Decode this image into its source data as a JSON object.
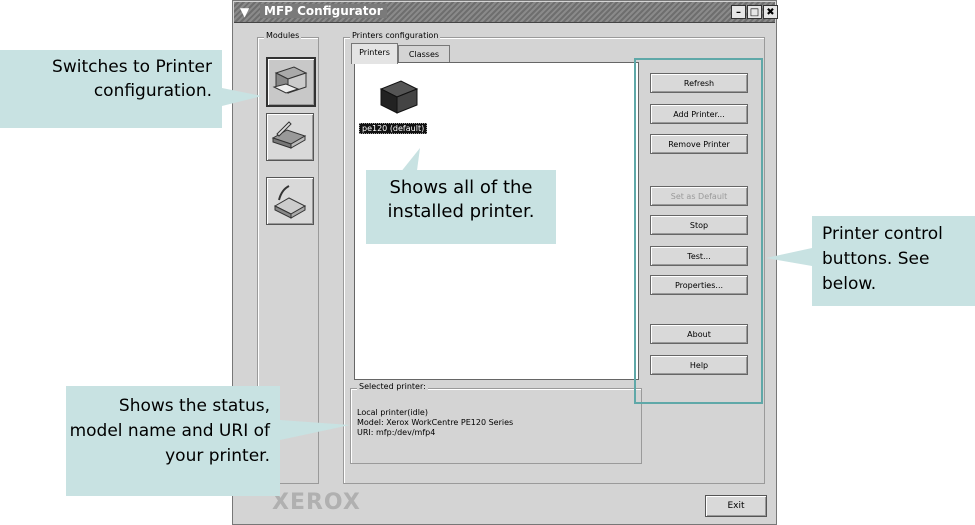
{
  "window": {
    "title": "MFP Configurator",
    "controls": {
      "minimize": "–",
      "maximize": "□",
      "close": "✖"
    }
  },
  "modules": {
    "label": "Modules",
    "items": [
      {
        "name": "Printer configuration",
        "icon": "printer-icon",
        "active": true
      },
      {
        "name": "Scanner configuration",
        "icon": "scanner-icon",
        "active": false
      },
      {
        "name": "Ports configuration",
        "icon": "port-icon",
        "active": false
      }
    ]
  },
  "printers_config": {
    "label": "Printers configuration",
    "tabs": [
      "Printers",
      "Classes"
    ],
    "printer_item": "pe120 (default)",
    "selected": {
      "label": "Selected printer:",
      "lines": [
        "Local printer(idle)",
        "Model: Xerox WorkCentre PE120 Series",
        "URI: mfp:/dev/mfp4"
      ]
    }
  },
  "buttons": {
    "refresh": "Refresh",
    "add_printer": "Add Printer...",
    "remove_printer": "Remove Printer",
    "set_default": "Set as Default",
    "stop": "Stop",
    "test": "Test...",
    "properties": "Properties...",
    "about": "About",
    "help": "Help",
    "exit": "Exit"
  },
  "brand": "XEROX",
  "callouts": {
    "modules": "Switches to Printer configuration.",
    "list": "Shows all of the installed printer.",
    "buttons": "Printer control buttons. See below.",
    "status": "Shows the status, model name and URI of your printer."
  },
  "colors": {
    "callout": "#c8e2e2",
    "highlight": "#5fa8a8"
  }
}
